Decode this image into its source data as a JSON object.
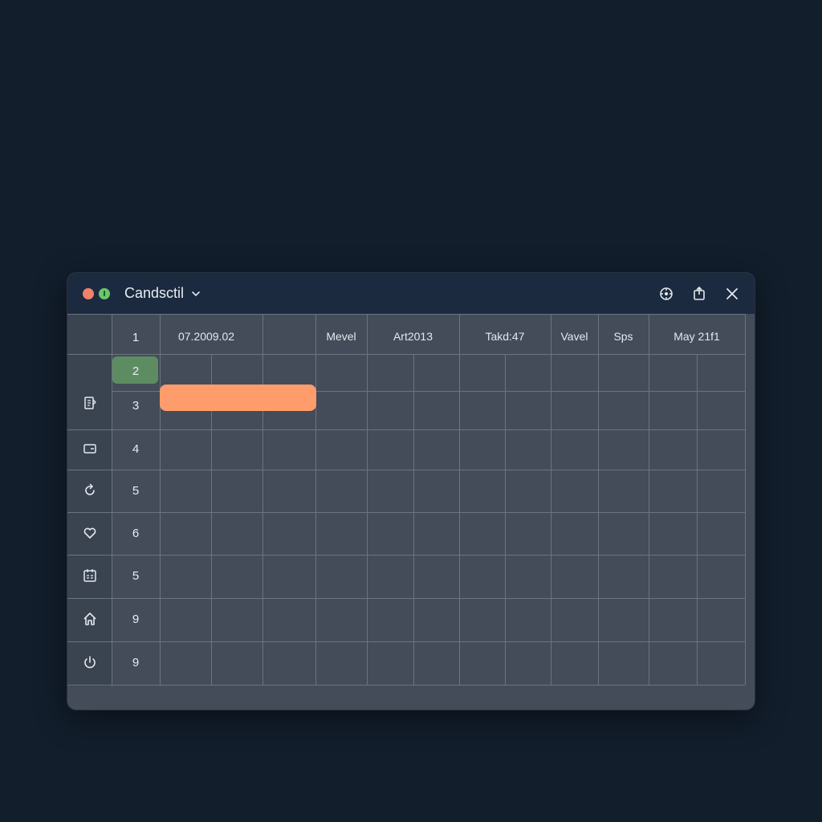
{
  "window": {
    "title": "Candsctil",
    "controls": [
      "settings-icon",
      "share-icon",
      "close-icon"
    ]
  },
  "header": {
    "row_label": "1",
    "columns": [
      "07.2009.02",
      "Mevel",
      "Art2013",
      "Takd:47",
      "Vavel",
      "Sps",
      "May 21f1"
    ]
  },
  "rows": [
    {
      "num": "2",
      "icon": ""
    },
    {
      "num": "3",
      "icon": "document-icon"
    },
    {
      "num": "4",
      "icon": "card-icon"
    },
    {
      "num": "5",
      "icon": "refresh-icon"
    },
    {
      "num": "6",
      "icon": "heart-icon"
    },
    {
      "num": "5",
      "icon": "calendar-icon"
    },
    {
      "num": "9",
      "icon": "home-icon"
    },
    {
      "num": "9",
      "icon": "power-icon"
    }
  ],
  "colors": {
    "background": "#121e2c",
    "titlebar": "#1c2a3f",
    "accent_bar": "#ff9c6b",
    "selected_row": "#5e8c62"
  }
}
